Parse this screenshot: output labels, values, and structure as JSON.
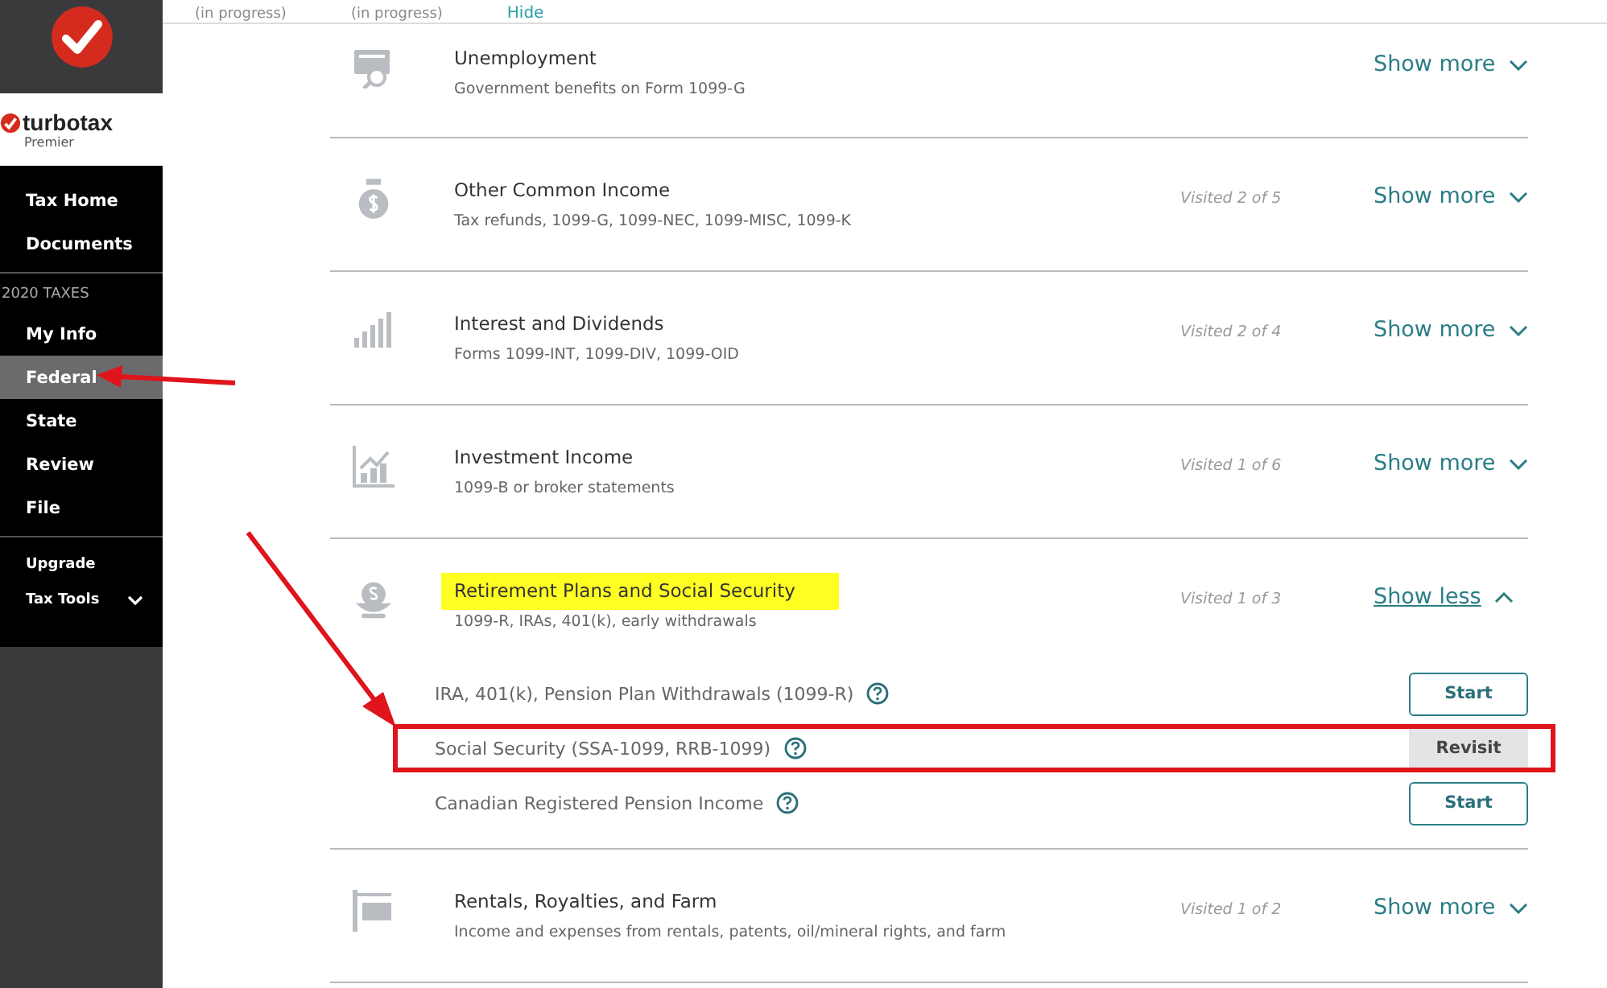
{
  "top_strip": {
    "texts": [
      "(in progress)",
      "(in progress)"
    ],
    "link": "Hide"
  },
  "sidebar": {
    "brand": {
      "name": "turbotax",
      "edition": "Premier"
    },
    "groups": [
      {
        "items": [
          {
            "label": "Tax Home",
            "selected": false
          },
          {
            "label": "Documents",
            "selected": false
          }
        ]
      },
      {
        "heading": "2020 TAXES",
        "items": [
          {
            "label": "My Info",
            "selected": false
          },
          {
            "label": "Federal",
            "selected": true,
            "annotated": true
          },
          {
            "label": "State",
            "selected": false
          },
          {
            "label": "Review",
            "selected": false
          },
          {
            "label": "File",
            "selected": false
          }
        ]
      },
      {
        "items": [
          {
            "label": "Upgrade",
            "selected": false
          },
          {
            "label": "Tax Tools",
            "selected": false,
            "menu": true
          }
        ]
      }
    ]
  },
  "sections": [
    {
      "kind": "document",
      "title": "Unemployment",
      "subtitle": "Government benefits on Form 1099-G",
      "toggle": "Show more",
      "expanded": false,
      "highlighted": false
    },
    {
      "kind": "moneybag",
      "title": "Other Common Income",
      "subtitle": "Tax refunds, 1099-G, 1099-NEC, 1099-MISC, 1099-K",
      "visited": "Visited 2 of 5",
      "toggle": "Show more",
      "expanded": false,
      "highlighted": false
    },
    {
      "kind": "bars",
      "title": "Interest and Dividends",
      "subtitle": "Forms 1099-INT, 1099-DIV, 1099-OID",
      "visited": "Visited 2 of 4",
      "toggle": "Show more",
      "expanded": false,
      "highlighted": false
    },
    {
      "kind": "chart",
      "title": "Investment Income",
      "subtitle": "1099-B or broker statements",
      "visited": "Visited 1 of 6",
      "toggle": "Show more",
      "expanded": false,
      "highlighted": false
    },
    {
      "kind": "nest",
      "title": "Retirement Plans and Social Security",
      "subtitle": "1099-R, IRAs, 401(k), early withdrawals",
      "visited": "Visited 1 of 3",
      "toggle": "Show less",
      "expanded": true,
      "highlighted": true,
      "items": [
        {
          "label": "IRA, 401(k), Pension Plan Withdrawals (1099-R)",
          "button": "Start",
          "kind": "start"
        },
        {
          "label": "Social Security (SSA-1099, RRB-1099)",
          "button": "Revisit",
          "kind": "revisit",
          "annotated": true
        },
        {
          "label": "Canadian Registered Pension Income",
          "button": "Start",
          "kind": "start"
        }
      ]
    },
    {
      "kind": "sign",
      "title": "Rentals, Royalties, and Farm",
      "subtitle": "Income and expenses from rentals, patents, oil/mineral rights, and farm",
      "visited": "Visited 1 of 2",
      "toggle": "Show more",
      "expanded": false,
      "highlighted": false
    }
  ]
}
